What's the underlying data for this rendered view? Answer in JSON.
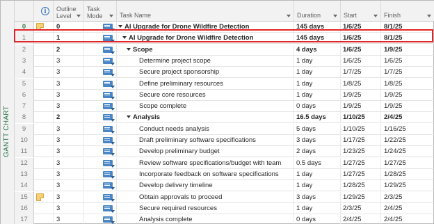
{
  "view_label": "GANTT CHART",
  "columns": {
    "info_icon": "info-icon",
    "outline_level": "Outline Level",
    "task_mode": "Task Mode",
    "task_name": "Task Name",
    "duration": "Duration",
    "start": "Start",
    "finish": "Finish"
  },
  "rows": [
    {
      "id": "0",
      "note": true,
      "level": "3",
      "name": "",
      "duration": "",
      "start": "",
      "finish": ""
    },
    {
      "id": "0",
      "note": true,
      "level": "0",
      "name": "AI Upgrade for Drone Wildfire Detection",
      "duration": "145 days",
      "start": "1/6/25",
      "finish": "8/1/25"
    },
    {
      "id": "1",
      "note": false,
      "level": "1",
      "name": "AI Upgrade for Drone Wildfire Detection",
      "duration": "145 days",
      "start": "1/6/25",
      "finish": "8/1/25"
    },
    {
      "id": "2",
      "note": false,
      "level": "2",
      "name": "Scope",
      "duration": "4 days",
      "start": "1/6/25",
      "finish": "1/9/25"
    },
    {
      "id": "3",
      "note": false,
      "level": "3",
      "name": "Determine project scope",
      "duration": "1 day",
      "start": "1/6/25",
      "finish": "1/6/25"
    },
    {
      "id": "4",
      "note": false,
      "level": "3",
      "name": "Secure project sponsorship",
      "duration": "1 day",
      "start": "1/7/25",
      "finish": "1/7/25"
    },
    {
      "id": "5",
      "note": false,
      "level": "3",
      "name": "Define preliminary resources",
      "duration": "1 day",
      "start": "1/8/25",
      "finish": "1/8/25"
    },
    {
      "id": "6",
      "note": false,
      "level": "3",
      "name": "Secure core resources",
      "duration": "1 day",
      "start": "1/9/25",
      "finish": "1/9/25"
    },
    {
      "id": "7",
      "note": false,
      "level": "3",
      "name": "Scope complete",
      "duration": "0 days",
      "start": "1/9/25",
      "finish": "1/9/25"
    },
    {
      "id": "8",
      "note": false,
      "level": "2",
      "name": "Analysis",
      "duration": "16.5 days",
      "start": "1/10/25",
      "finish": "2/4/25"
    },
    {
      "id": "9",
      "note": false,
      "level": "3",
      "name": "Conduct needs analysis",
      "duration": "5 days",
      "start": "1/10/25",
      "finish": "1/16/25"
    },
    {
      "id": "10",
      "note": false,
      "level": "3",
      "name": "Draft preliminary software specifications",
      "duration": "3 days",
      "start": "1/17/25",
      "finish": "1/22/25"
    },
    {
      "id": "11",
      "note": false,
      "level": "3",
      "name": "Develop preliminary budget",
      "duration": "2 days",
      "start": "1/23/25",
      "finish": "1/24/25"
    },
    {
      "id": "12",
      "note": false,
      "level": "3",
      "name": "Review software specifications/budget with team",
      "duration": "0.5 days",
      "start": "1/27/25",
      "finish": "1/27/25"
    },
    {
      "id": "13",
      "note": false,
      "level": "3",
      "name": "Incorporate feedback on software specifications",
      "duration": "1 day",
      "start": "1/27/25",
      "finish": "1/28/25"
    },
    {
      "id": "14",
      "note": false,
      "level": "3",
      "name": "Develop delivery timeline",
      "duration": "1 day",
      "start": "1/28/25",
      "finish": "1/29/25"
    },
    {
      "id": "15",
      "note": true,
      "level": "3",
      "name": "Obtain approvals to proceed",
      "duration": "3 days",
      "start": "1/29/25",
      "finish": "2/3/25"
    },
    {
      "id": "16",
      "note": false,
      "level": "3",
      "name": "Secure required resources",
      "duration": "1 day",
      "start": "2/3/25",
      "finish": "2/4/25"
    },
    {
      "id": "17",
      "note": false,
      "level": "3",
      "name": "Analysis complete",
      "duration": "0 days",
      "start": "2/4/25",
      "finish": "2/4/25"
    }
  ]
}
